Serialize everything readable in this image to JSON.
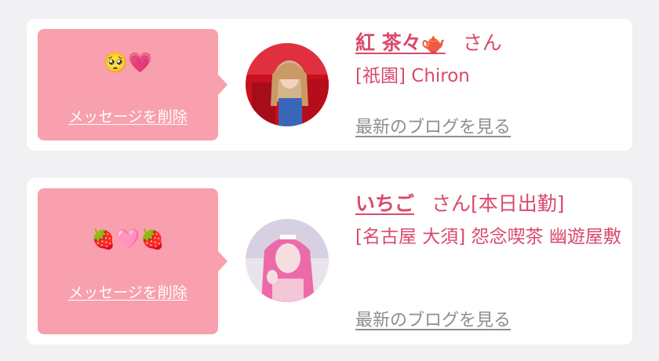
{
  "colors": {
    "background": "#f1f1f3",
    "card": "#ffffff",
    "bubble": "#f8a0ad",
    "accent": "#d94a6b",
    "muted": "#8e8e8e"
  },
  "messages": [
    {
      "bubble_text": "🥺💗",
      "delete_label": "メッセージを削除",
      "name": "紅 茶々🫖",
      "suffix": "さん",
      "shop": "[祇園] Chiron",
      "blog_label": "最新のブログを見る",
      "avatar_icon": "avatar-photo"
    },
    {
      "bubble_text": "🍓🩷🍓",
      "delete_label": "メッセージを削除",
      "name": "いちご",
      "suffix": "さん[本日出勤]",
      "shop": "[名古屋 大須] 怨念喫茶 幽遊屋敷",
      "blog_label": "最新のブログを見る",
      "avatar_icon": "avatar-photo"
    }
  ]
}
